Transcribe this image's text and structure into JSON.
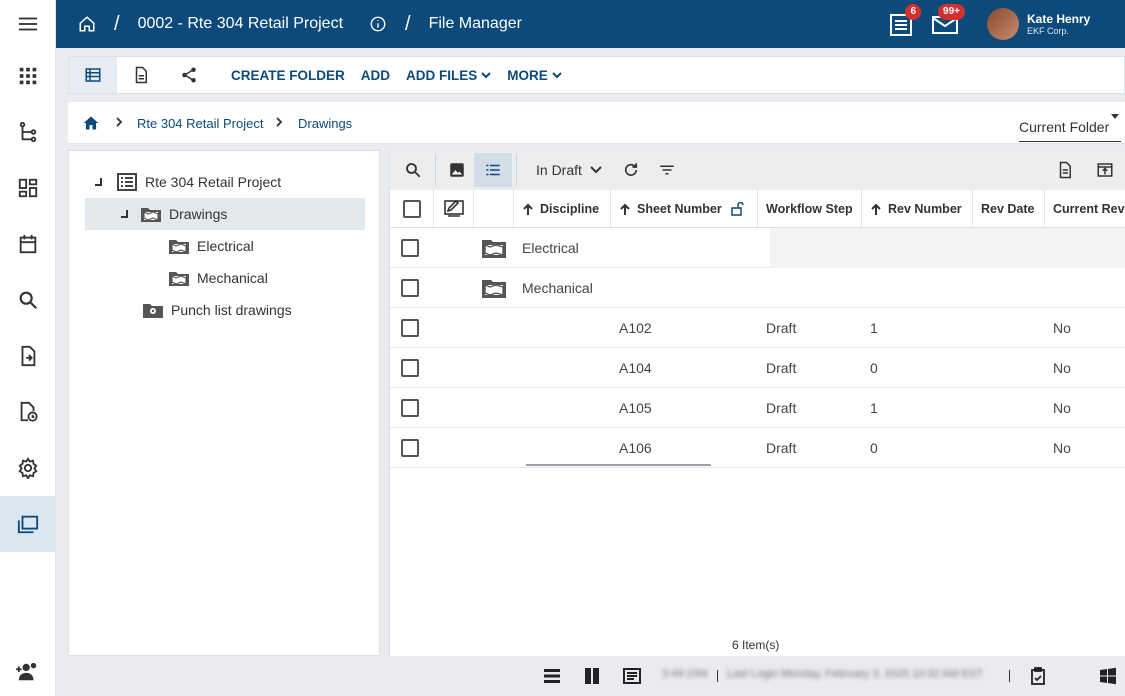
{
  "topbar": {
    "project": "0002 - Rte 304 Retail Project",
    "page": "File Manager",
    "tasks_badge": "6",
    "mail_badge": "99+",
    "user_name": "Kate Henry",
    "user_org": "EKF Corp."
  },
  "rail": {
    "items": [
      "menu-icon",
      "apps-icon",
      "workflow-icon",
      "dashboard-icon",
      "calendar-icon",
      "search-icon",
      "document-icon",
      "history-icon",
      "settings-icon",
      "folders-icon",
      "add-user-icon"
    ],
    "active": "folders-icon"
  },
  "toolbar": {
    "create_folder": "CREATE FOLDER",
    "add": "ADD",
    "add_files": "ADD FILES",
    "more": "MORE"
  },
  "breadcrumb": {
    "items": [
      "Rte 304 Retail Project",
      "Drawings"
    ],
    "scope": "Current Folder"
  },
  "tree": {
    "root": "Rte 304 Retail Project",
    "drawings": "Drawings",
    "electrical": "Electrical",
    "mechanical": "Mechanical",
    "punch": "Punch list drawings"
  },
  "grid": {
    "filter": "In Draft",
    "columns": [
      "Discipline",
      "Sheet Number",
      "Workflow Step",
      "Rev Number",
      "Rev Date",
      "Current Rev"
    ],
    "folders": [
      "Electrical",
      "Mechanical"
    ],
    "rows": [
      {
        "sheet": "A102",
        "step": "Draft",
        "rev": "1",
        "current": "No"
      },
      {
        "sheet": "A104",
        "step": "Draft",
        "rev": "0",
        "current": "No"
      },
      {
        "sheet": "A105",
        "step": "Draft",
        "rev": "1",
        "current": "No"
      },
      {
        "sheet": "A106",
        "step": "Draft",
        "rev": "0",
        "current": "No"
      }
    ],
    "count": "6  Item(s)"
  },
  "status": {
    "time": "3:49:15M",
    "last_login": "Last Login Monday, February 3, 2025 10:32 AM EST"
  },
  "colors": {
    "brand": "#0d4a7c",
    "badge": "#d32f2f"
  }
}
